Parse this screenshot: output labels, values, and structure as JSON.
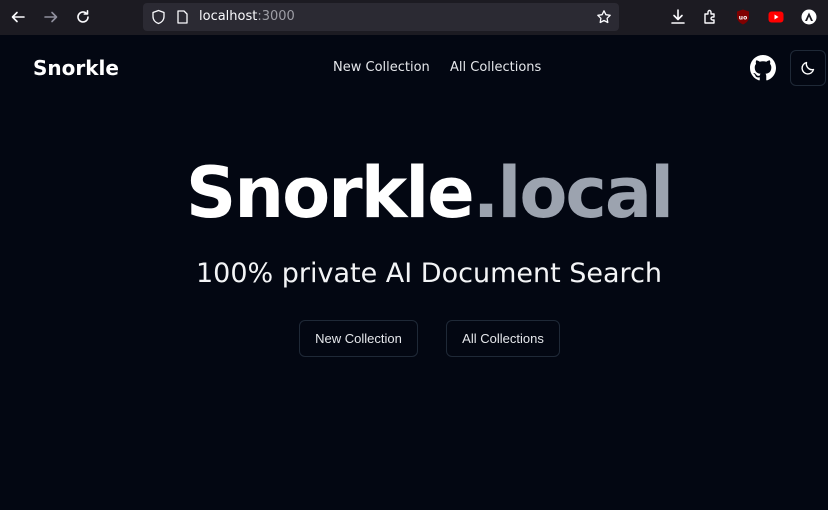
{
  "browser": {
    "url_host": "localhost",
    "url_port": ":3000",
    "icons": [
      "back-icon",
      "forward-icon",
      "reload-icon",
      "shield-icon",
      "page-icon",
      "bookmark-star-icon",
      "download-icon",
      "extensions-icon",
      "ublock-icon",
      "youtube-icon",
      "profile-icon"
    ]
  },
  "navbar": {
    "brand": "Snorkle",
    "links": [
      "New Collection",
      "All Collections"
    ]
  },
  "hero": {
    "title_main": "Snorkle",
    "title_suffix": ".local",
    "subtitle": "100% private AI Document Search",
    "buttons": [
      "New Collection",
      "All Collections"
    ]
  },
  "colors": {
    "background": "#030712",
    "title_suffix": "#9ca3af",
    "border": "#1f2937"
  }
}
